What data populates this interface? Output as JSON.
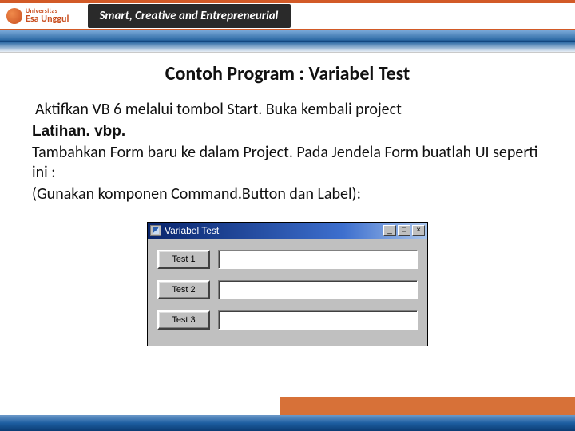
{
  "header": {
    "university_small": "Universitas",
    "university_name": "Esa Unggul",
    "tagline": "Smart, Creative and Entrepreneurial"
  },
  "slide": {
    "title": "Contoh Program : Variabel Test",
    "line1a": "Aktifkan VB 6 melalui tombol Start. Buka kembali project",
    "line1b_bold": "Latihan. vbp.",
    "line2": "Tambahkan Form baru ke dalam Project. Pada Jendela Form buatlah UI seperti ini :",
    "line3": "(Gunakan komponen Command.Button dan Label):"
  },
  "vb_window": {
    "title": "Variabel Test",
    "minimize": "_",
    "maximize": "□",
    "close": "×",
    "buttons": [
      "Test 1",
      "Test 2",
      "Test 3"
    ]
  }
}
